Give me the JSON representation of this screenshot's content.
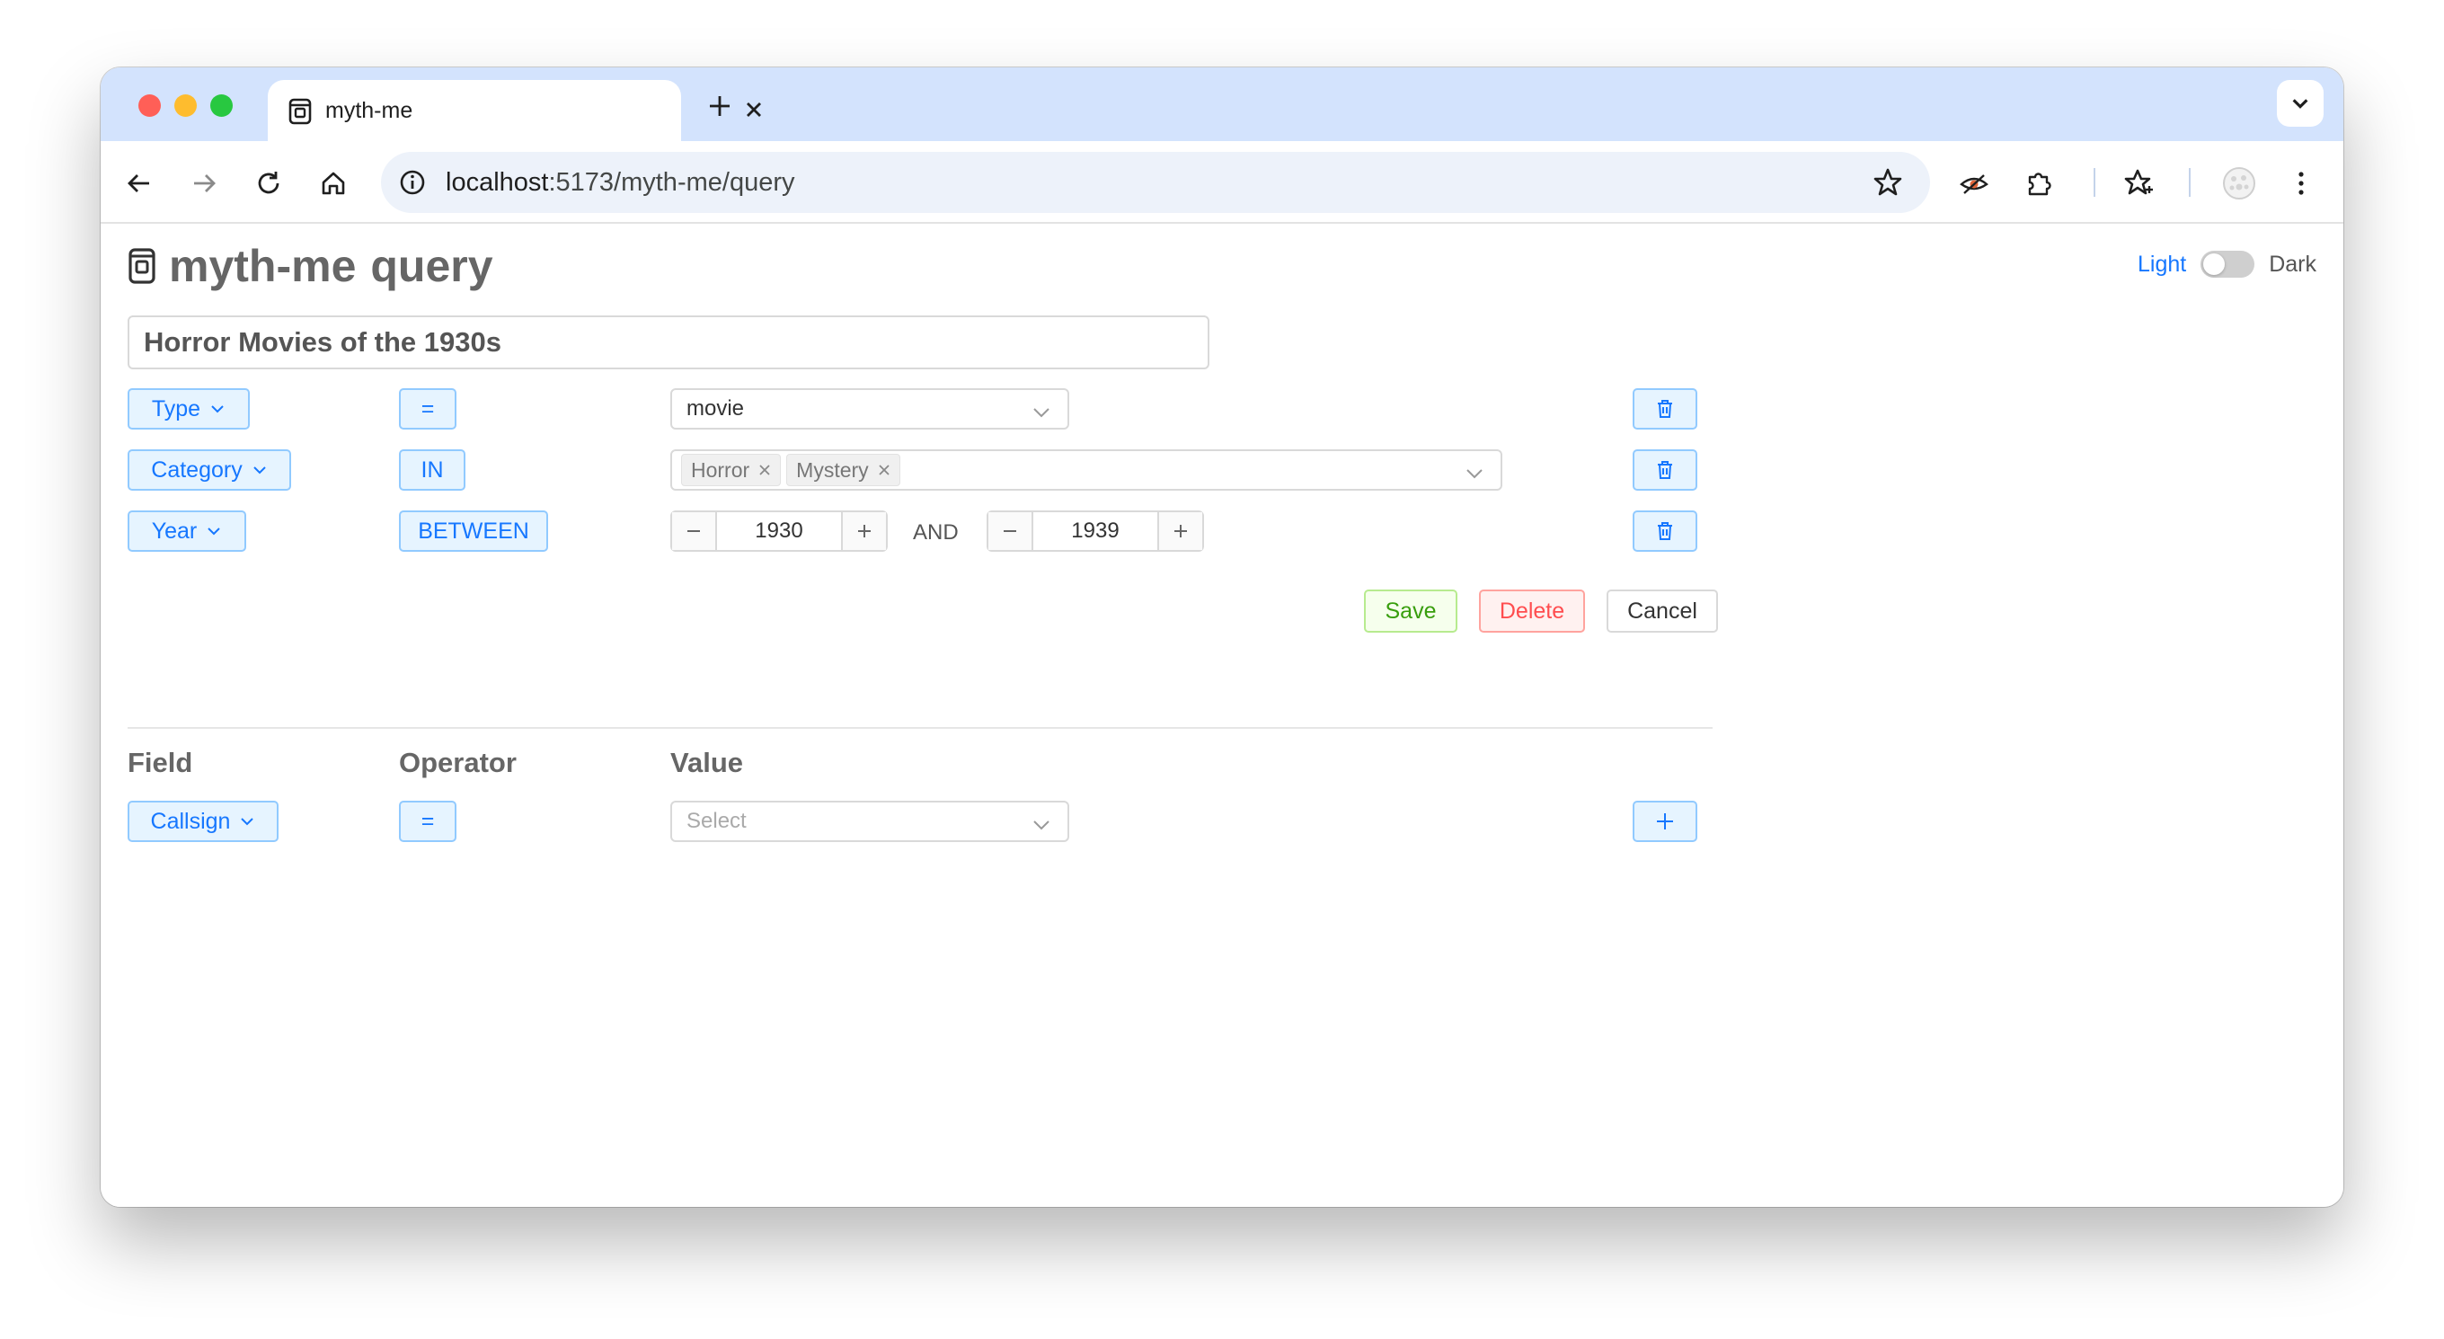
{
  "browser": {
    "tab_title": "myth-me",
    "url_host": "localhost",
    "url_path": ":5173/myth-me/query"
  },
  "app": {
    "title": "myth-me",
    "subtitle": "query",
    "theme_light": "Light",
    "theme_dark": "Dark"
  },
  "query": {
    "name": "Horror Movies of the 1930s",
    "conditions": [
      {
        "field": "Type",
        "operator": "=",
        "value": "movie"
      },
      {
        "field": "Category",
        "operator": "IN",
        "tags": [
          "Horror",
          "Mystery"
        ]
      },
      {
        "field": "Year",
        "operator": "BETWEEN",
        "from": "1930",
        "joiner": "AND",
        "to": "1939"
      }
    ]
  },
  "actions": {
    "save": "Save",
    "delete": "Delete",
    "cancel": "Cancel"
  },
  "new_condition": {
    "headers": {
      "field": "Field",
      "operator": "Operator",
      "value": "Value"
    },
    "field": "Callsign",
    "operator": "=",
    "value_placeholder": "Select"
  },
  "colors": {
    "accent": "#1677ff",
    "save": "#389e0d",
    "delete": "#ff4d4f",
    "tabbar": "#d3e3fd"
  }
}
